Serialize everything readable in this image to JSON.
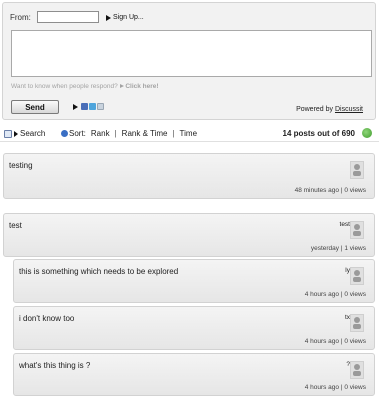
{
  "form": {
    "from_label": "From:",
    "from_value": "",
    "signup": "Sign Up...",
    "comment_value": "",
    "want_text": "Want to know when people respond?",
    "click_here": "Click here!",
    "send": "Send",
    "powered_prefix": "Powered by ",
    "powered_link": "Discussit"
  },
  "toolbar": {
    "search": "Search",
    "sort_label": "Sort:",
    "sort_options": [
      "Rank",
      "Rank & Time",
      "Time"
    ],
    "posts_count": "14 posts out of 690"
  },
  "posts": [
    {
      "text": "testing",
      "author": "",
      "meta": "48 minutes ago | 0 views"
    },
    {
      "text": "test",
      "author": "test",
      "meta": "yesterday | 1 views"
    },
    {
      "text": "this is something which needs to be explored",
      "author": "ly",
      "meta": "4 hours ago | 0 views"
    },
    {
      "text": "i don't know too",
      "author": "tx",
      "meta": "4 hours ago | 0 views"
    },
    {
      "text": "what's this thing is ?",
      "author": "?",
      "meta": "4 hours ago | 0 views"
    }
  ],
  "icons": {
    "share": [
      "facebook-icon",
      "twitter-icon",
      "email-icon"
    ],
    "avatar": "avatar-placeholder-icon",
    "refresh": "refresh-icon"
  }
}
